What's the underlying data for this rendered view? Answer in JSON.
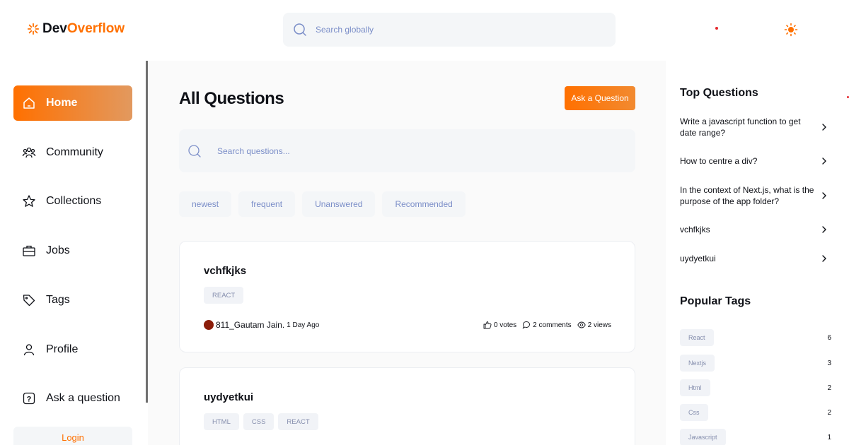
{
  "header": {
    "logo_part1": "Dev",
    "logo_part2": "Overflow",
    "search_placeholder": "Search globally"
  },
  "sidebar": {
    "items": [
      {
        "label": "Home",
        "icon": "home-icon",
        "active": true
      },
      {
        "label": "Community",
        "icon": "users-icon"
      },
      {
        "label": "Collections",
        "icon": "star-icon"
      },
      {
        "label": "Jobs",
        "icon": "suitcase-icon"
      },
      {
        "label": "Tags",
        "icon": "tag-icon"
      },
      {
        "label": "Profile",
        "icon": "user-icon"
      },
      {
        "label": "Ask a question",
        "icon": "question-icon"
      }
    ],
    "login_label": "Login"
  },
  "main": {
    "title": "All Questions",
    "ask_button": "Ask a Question",
    "search_placeholder": "Search questions...",
    "filters": [
      "newest",
      "frequent",
      "Unanswered",
      "Recommended"
    ],
    "questions": [
      {
        "title": "vchfkjks",
        "tags": [
          "REACT"
        ],
        "author": "811_Gautam Jain.",
        "time": "1 Day Ago",
        "votes": "0 votes",
        "comments": "2 comments",
        "views": "2 views"
      },
      {
        "title": "uydyetkui",
        "tags": [
          "HTML",
          "CSS",
          "REACT"
        ]
      }
    ]
  },
  "right": {
    "top_questions_title": "Top Questions",
    "top_questions": [
      "Write a javascript function to get date range?",
      "How to centre a div?",
      "In the context of Next.js, what is the purpose of the app folder?",
      "vchfkjks",
      "uydyetkui"
    ],
    "popular_tags_title": "Popular Tags",
    "popular_tags": [
      {
        "name": "React",
        "count": "6"
      },
      {
        "name": "Nextjs",
        "count": "3"
      },
      {
        "name": "Html",
        "count": "2"
      },
      {
        "name": "Css",
        "count": "2"
      },
      {
        "name": "Javascript",
        "count": "1"
      }
    ]
  },
  "colors": {
    "accent": "#ff7000",
    "muted_blue": "#7b8ec8",
    "background": "#fafafa"
  }
}
